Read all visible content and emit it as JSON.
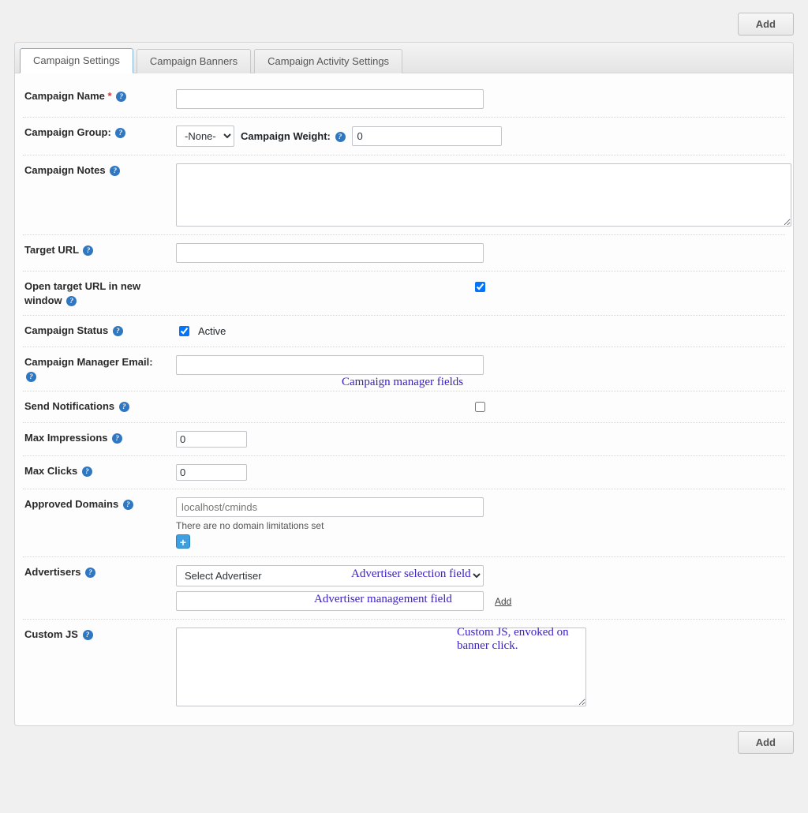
{
  "buttons": {
    "add_top": "Add",
    "add_bottom": "Add"
  },
  "tabs": [
    {
      "label": "Campaign Settings",
      "active": true
    },
    {
      "label": "Campaign Banners",
      "active": false
    },
    {
      "label": "Campaign Activity Settings",
      "active": false
    }
  ],
  "labels": {
    "campaign_name": "Campaign Name",
    "campaign_group": "Campaign Group:",
    "campaign_weight": "Campaign Weight:",
    "campaign_notes": "Campaign Notes",
    "target_url": "Target URL",
    "open_new": "Open target URL in new window",
    "campaign_status": "Campaign Status",
    "status_text": "Active",
    "manager_email": "Campaign Manager Email:",
    "send_notifications": "Send Notifications",
    "max_impressions": "Max Impressions",
    "max_clicks": "Max Clicks",
    "approved_domains": "Approved Domains",
    "advertisers": "Advertisers",
    "custom_js": "Custom JS"
  },
  "values": {
    "campaign_name": "",
    "group_selected": "-None-",
    "weight": "0",
    "notes": "",
    "target_url": "",
    "open_new_checked": true,
    "status_checked": true,
    "manager_email": "",
    "send_notifications_checked": false,
    "max_impressions": "0",
    "max_clicks": "0",
    "domain_placeholder": "localhost/cminds",
    "domain_hint": "There are no domain limitations set",
    "advertiser_selected": "Select Advertiser",
    "advertiser_new": "",
    "add_link": "Add",
    "custom_js": ""
  },
  "group_options": [
    "-None-"
  ],
  "advertiser_options": [
    "Select Advertiser"
  ],
  "callouts": {
    "manager": "Campaign manager fields",
    "adv_select": "Advertiser selection field",
    "adv_manage": "Advertiser management field",
    "custom_js": "Custom JS, envoked on banner click."
  }
}
